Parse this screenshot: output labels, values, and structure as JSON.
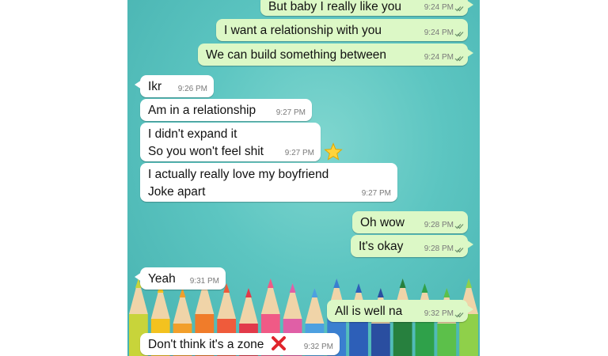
{
  "chat": {
    "messages": [
      {
        "dir": "out",
        "lines": [
          "But baby I really like you"
        ],
        "time": "9:24 PM"
      },
      {
        "dir": "out",
        "lines": [
          "I want a relationship with you"
        ],
        "time": "9:24 PM"
      },
      {
        "dir": "out",
        "lines": [
          "We can build something between"
        ],
        "time": "9:24 PM"
      },
      {
        "dir": "in",
        "lines": [
          "Ikr"
        ],
        "time": "9:26 PM"
      },
      {
        "dir": "in",
        "lines": [
          "Am in a relationship"
        ],
        "time": "9:27 PM"
      },
      {
        "dir": "in",
        "lines": [
          "I didn't expand it",
          "So you won't feel shit"
        ],
        "time": "9:27 PM"
      },
      {
        "dir": "in",
        "lines": [
          "I actually really love my boyfriend",
          "Joke apart"
        ],
        "time": "9:27 PM"
      },
      {
        "dir": "out",
        "lines": [
          "Oh wow"
        ],
        "time": "9:28 PM"
      },
      {
        "dir": "out",
        "lines": [
          "It's okay"
        ],
        "time": "9:28 PM"
      },
      {
        "dir": "in",
        "lines": [
          "Yeah"
        ],
        "time": "9:31 PM"
      },
      {
        "dir": "out",
        "lines": [
          "All is well na"
        ],
        "time": "9:32 PM"
      },
      {
        "dir": "in",
        "lines": [
          "Don't think it's a zone"
        ],
        "time": "9:32 PM"
      }
    ]
  },
  "decorations": {
    "emoji_star": "star-emoji",
    "emoji_cross": "cross-mark-emoji",
    "tick_icon": "double-check-icon",
    "tick_color": "#4a8c4a"
  }
}
